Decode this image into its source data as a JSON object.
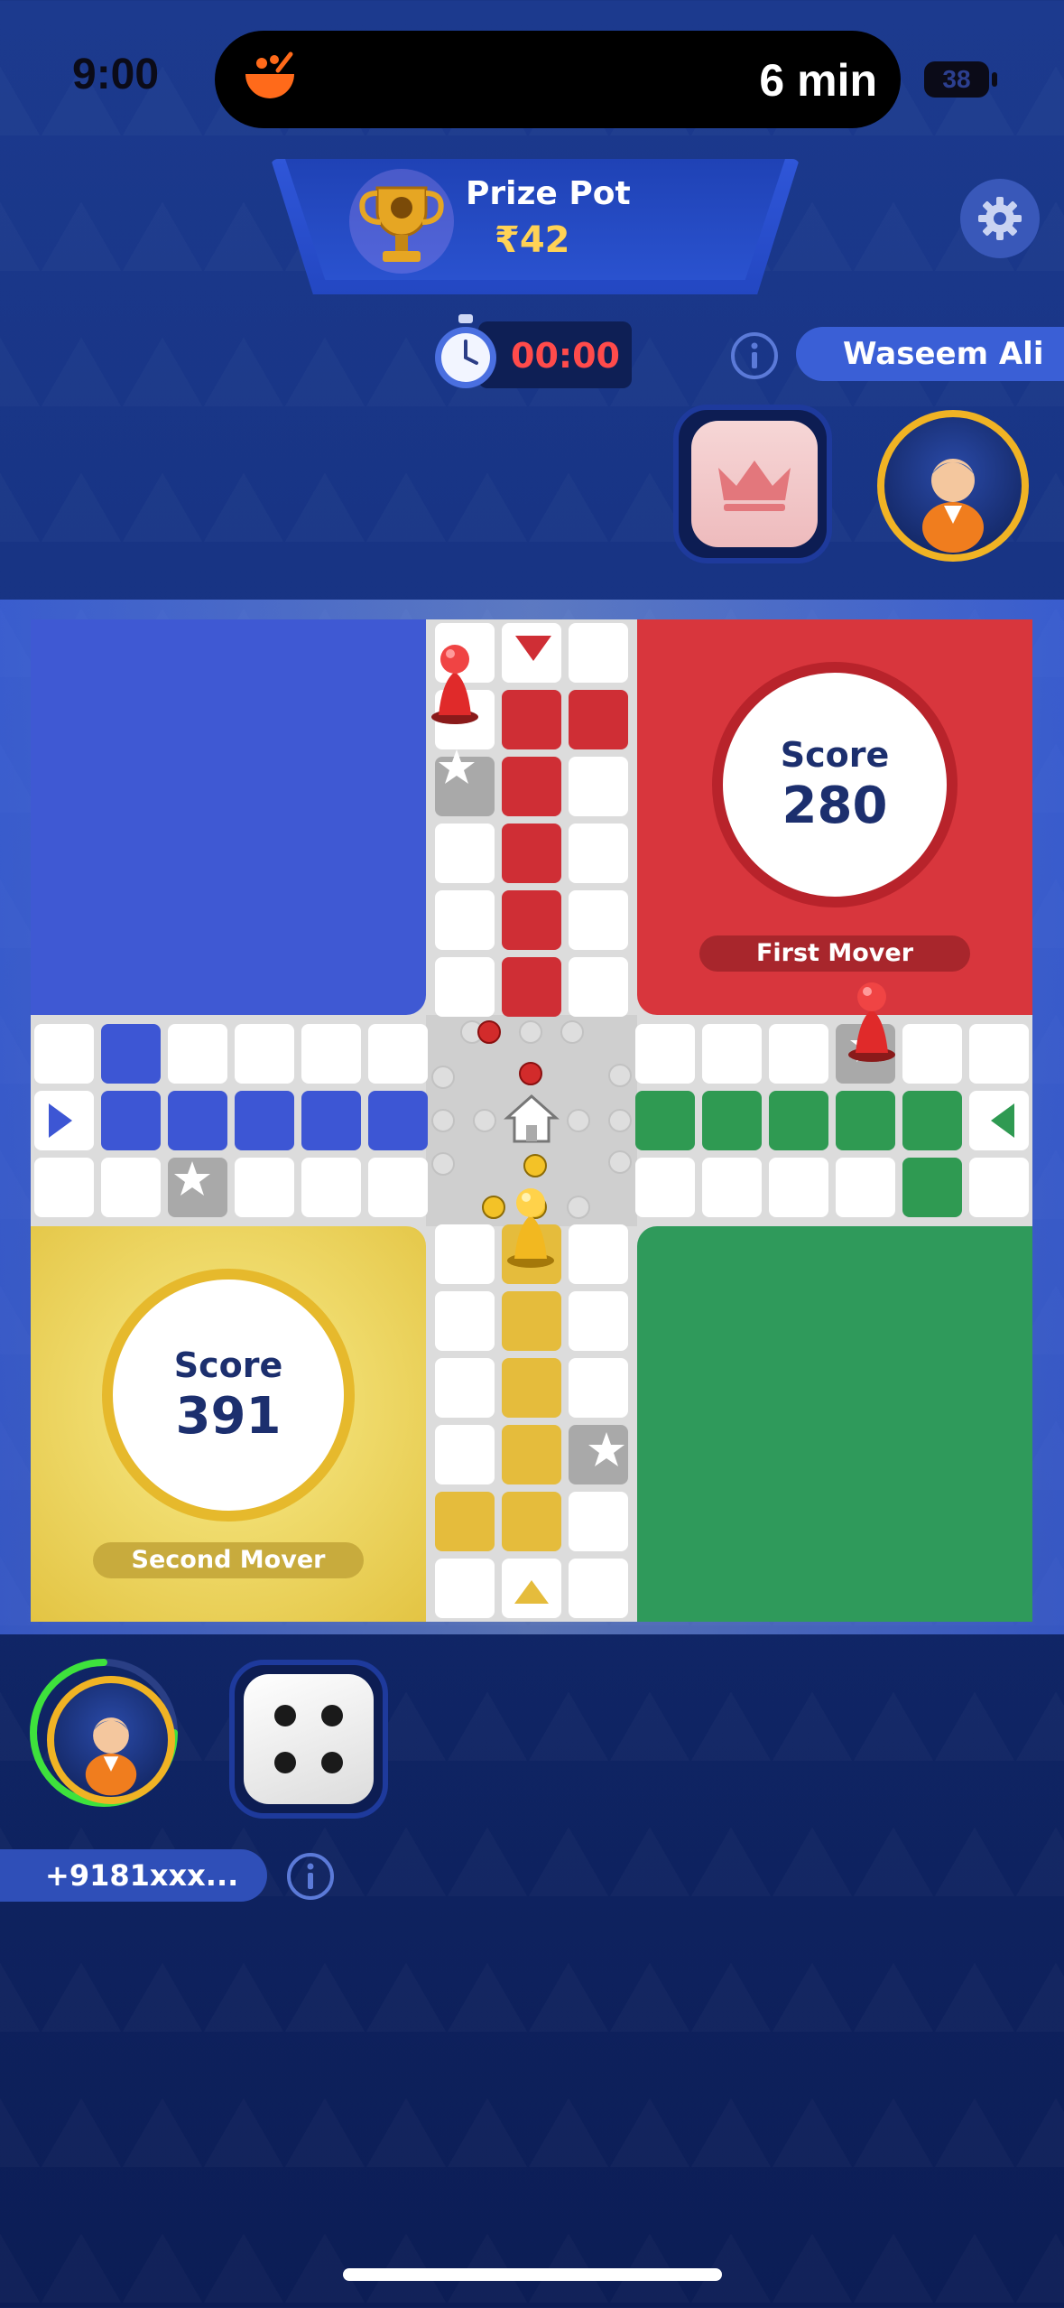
{
  "status_bar": {
    "time": "9:00",
    "activity_text": "6 min",
    "battery": "38"
  },
  "header": {
    "prize_label": "Prize Pot",
    "prize_value": "₹42",
    "timer": "00:00"
  },
  "opponent": {
    "name": "Waseem Ali",
    "color": "red",
    "dice_face": "crown-icon"
  },
  "player": {
    "name": "+9181xxx...",
    "color": "yellow",
    "dice_value": 4
  },
  "board": {
    "red": {
      "score_label": "Score",
      "score": "280",
      "role": "First Mover"
    },
    "yellow": {
      "score_label": "Score",
      "score": "391",
      "role": "Second Mover"
    }
  },
  "colors": {
    "red": "#d8363d",
    "blue": "#3f59d3",
    "yellow": "#e5bc3c",
    "green": "#2f9a5b",
    "accent_gold": "#f0b324",
    "timer_red": "#ff4b4b"
  }
}
